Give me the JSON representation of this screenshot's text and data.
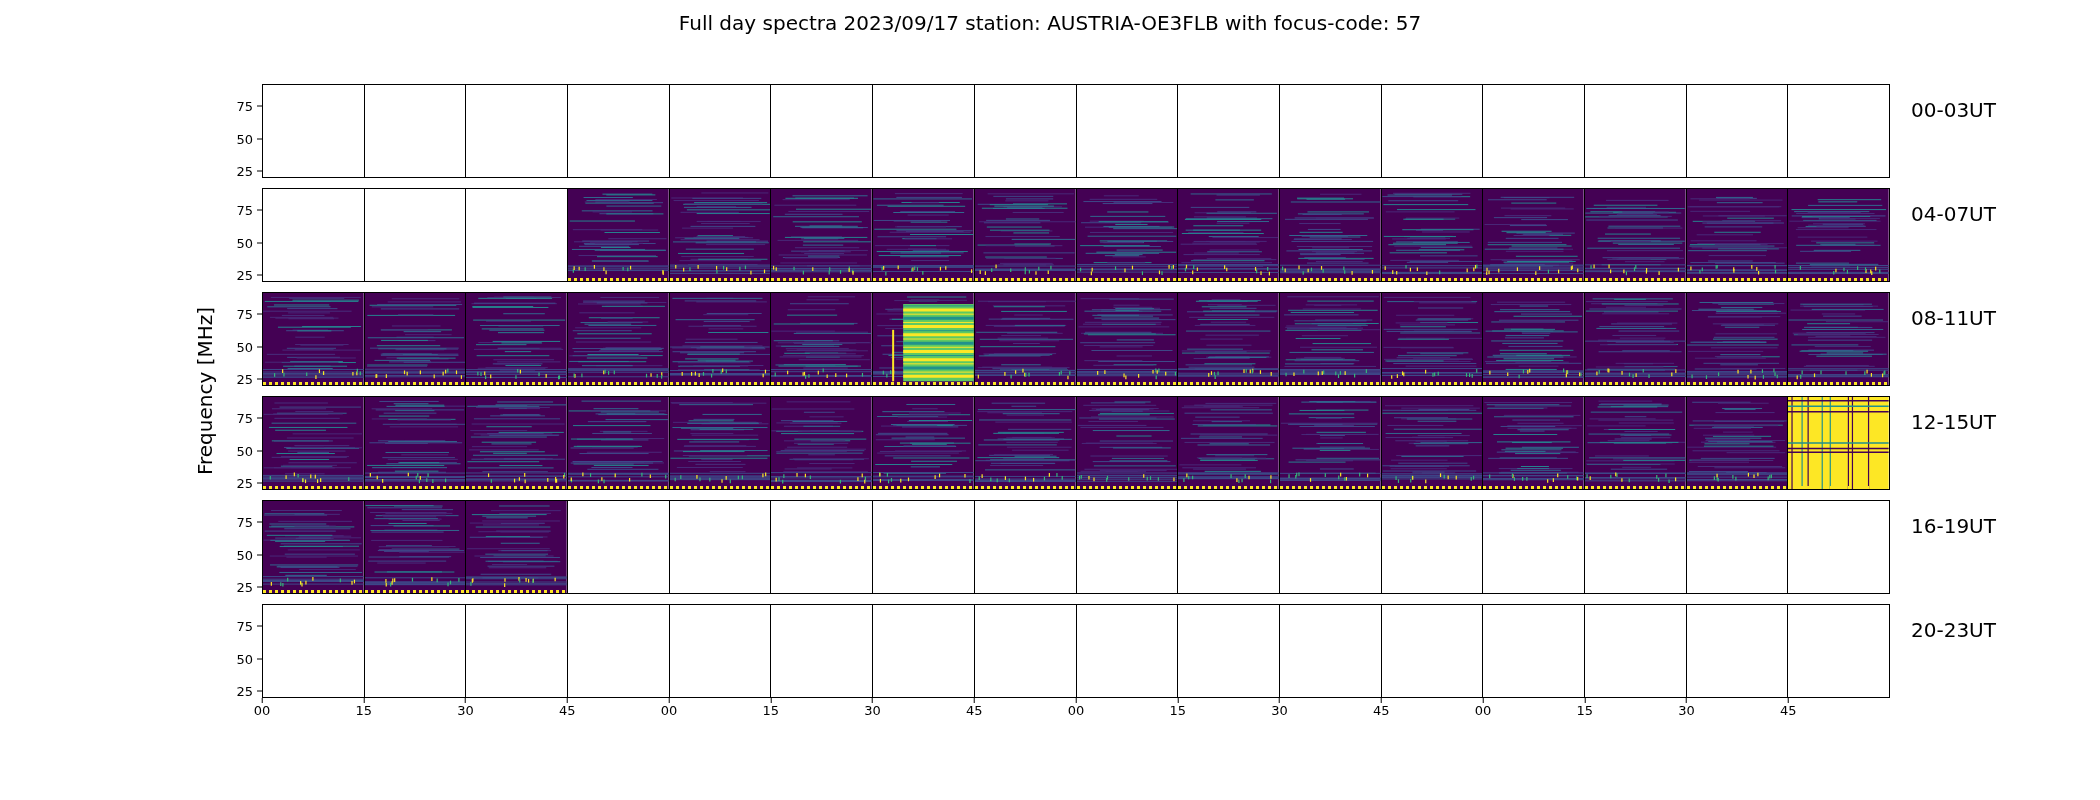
{
  "title": "Full day spectra 2023/09/17 station: AUSTRIA-OE3FLB with focus-code: 57",
  "ylabel": "Frequency [MHz]",
  "rows": [
    {
      "label": "00-03UT",
      "yticks": [
        "75",
        "50",
        "25"
      ],
      "panels": [
        {
          "kind": "empty"
        },
        {
          "kind": "empty"
        },
        {
          "kind": "empty"
        },
        {
          "kind": "empty"
        },
        {
          "kind": "empty"
        },
        {
          "kind": "empty"
        },
        {
          "kind": "empty"
        },
        {
          "kind": "empty"
        },
        {
          "kind": "empty"
        },
        {
          "kind": "empty"
        },
        {
          "kind": "empty"
        },
        {
          "kind": "empty"
        },
        {
          "kind": "empty"
        },
        {
          "kind": "empty"
        },
        {
          "kind": "empty"
        },
        {
          "kind": "empty"
        }
      ]
    },
    {
      "label": "04-07UT",
      "yticks": [
        "75",
        "50",
        "25"
      ],
      "panels": [
        {
          "kind": "empty"
        },
        {
          "kind": "empty"
        },
        {
          "kind": "empty"
        },
        {
          "kind": "spectrum"
        },
        {
          "kind": "spectrum"
        },
        {
          "kind": "spectrum"
        },
        {
          "kind": "spectrum"
        },
        {
          "kind": "spectrum"
        },
        {
          "kind": "spectrum"
        },
        {
          "kind": "spectrum"
        },
        {
          "kind": "spectrum"
        },
        {
          "kind": "spectrum"
        },
        {
          "kind": "spectrum"
        },
        {
          "kind": "spectrum"
        },
        {
          "kind": "spectrum"
        },
        {
          "kind": "spectrum"
        }
      ]
    },
    {
      "label": "08-11UT",
      "yticks": [
        "75",
        "50",
        "25"
      ],
      "panels": [
        {
          "kind": "spectrum"
        },
        {
          "kind": "spectrum"
        },
        {
          "kind": "spectrum"
        },
        {
          "kind": "spectrum"
        },
        {
          "kind": "spectrum"
        },
        {
          "kind": "spectrum"
        },
        {
          "kind": "burst"
        },
        {
          "kind": "spectrum"
        },
        {
          "kind": "spectrum"
        },
        {
          "kind": "spectrum"
        },
        {
          "kind": "spectrum"
        },
        {
          "kind": "spectrum"
        },
        {
          "kind": "spectrum"
        },
        {
          "kind": "spectrum"
        },
        {
          "kind": "spectrum"
        },
        {
          "kind": "spectrum"
        }
      ]
    },
    {
      "label": "12-15UT",
      "yticks": [
        "75",
        "50",
        "25"
      ],
      "panels": [
        {
          "kind": "spectrum"
        },
        {
          "kind": "spectrum"
        },
        {
          "kind": "spectrum"
        },
        {
          "kind": "spectrum"
        },
        {
          "kind": "spectrum"
        },
        {
          "kind": "spectrum"
        },
        {
          "kind": "spectrum"
        },
        {
          "kind": "spectrum"
        },
        {
          "kind": "spectrum"
        },
        {
          "kind": "spectrum"
        },
        {
          "kind": "spectrum"
        },
        {
          "kind": "spectrum"
        },
        {
          "kind": "spectrum"
        },
        {
          "kind": "spectrum"
        },
        {
          "kind": "spectrum"
        },
        {
          "kind": "saturated"
        }
      ]
    },
    {
      "label": "16-19UT",
      "yticks": [
        "75",
        "50",
        "25"
      ],
      "panels": [
        {
          "kind": "spectrum"
        },
        {
          "kind": "spectrum"
        },
        {
          "kind": "spectrum"
        },
        {
          "kind": "empty"
        },
        {
          "kind": "empty"
        },
        {
          "kind": "empty"
        },
        {
          "kind": "empty"
        },
        {
          "kind": "empty"
        },
        {
          "kind": "empty"
        },
        {
          "kind": "empty"
        },
        {
          "kind": "empty"
        },
        {
          "kind": "empty"
        },
        {
          "kind": "empty"
        },
        {
          "kind": "empty"
        },
        {
          "kind": "empty"
        },
        {
          "kind": "empty"
        }
      ]
    },
    {
      "label": "20-23UT",
      "yticks": [
        "75",
        "50",
        "25"
      ],
      "panels": [
        {
          "kind": "empty"
        },
        {
          "kind": "empty"
        },
        {
          "kind": "empty"
        },
        {
          "kind": "empty"
        },
        {
          "kind": "empty"
        },
        {
          "kind": "empty"
        },
        {
          "kind": "empty"
        },
        {
          "kind": "empty"
        },
        {
          "kind": "empty"
        },
        {
          "kind": "empty"
        },
        {
          "kind": "empty"
        },
        {
          "kind": "empty"
        },
        {
          "kind": "empty"
        },
        {
          "kind": "empty"
        },
        {
          "kind": "empty"
        },
        {
          "kind": "empty"
        }
      ]
    }
  ],
  "xticks": [
    "00",
    "15",
    "30",
    "45",
    "00",
    "15",
    "30",
    "45",
    "00",
    "15",
    "30",
    "45",
    "00",
    "15",
    "30",
    "45"
  ]
}
